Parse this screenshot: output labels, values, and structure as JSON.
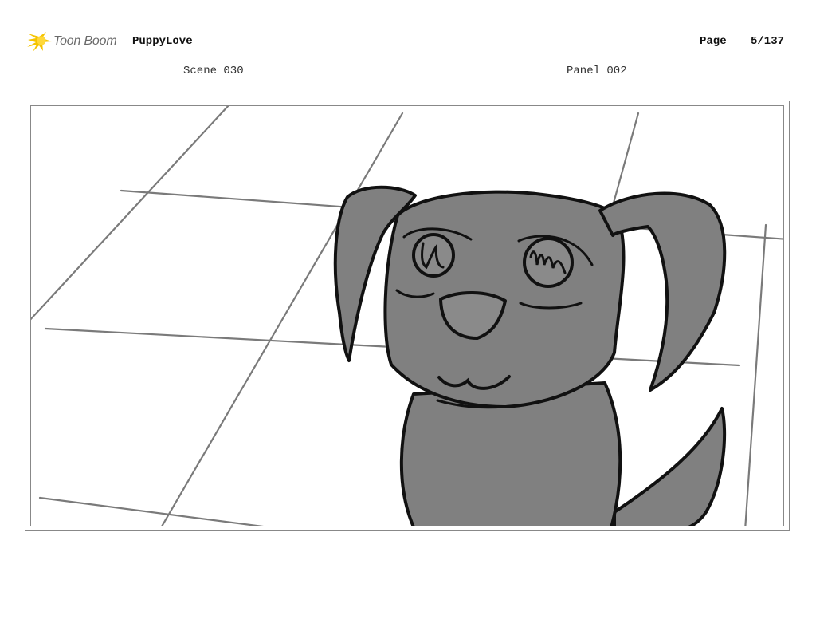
{
  "header": {
    "logo_text": "Toon Boom",
    "logo_icon": "toon-boom-star-icon",
    "project_title": "PuppyLove",
    "page_label": "Page",
    "page_number": "5/137"
  },
  "panel_info": {
    "scene": "Scene 030",
    "panel": "Panel 002"
  },
  "drawing": {
    "subject": "puppy-sketch",
    "fill_color": "#808080",
    "line_color": "#111111",
    "floor_line_color": "#7a7a7a",
    "logo_accent": "#f5c400"
  }
}
